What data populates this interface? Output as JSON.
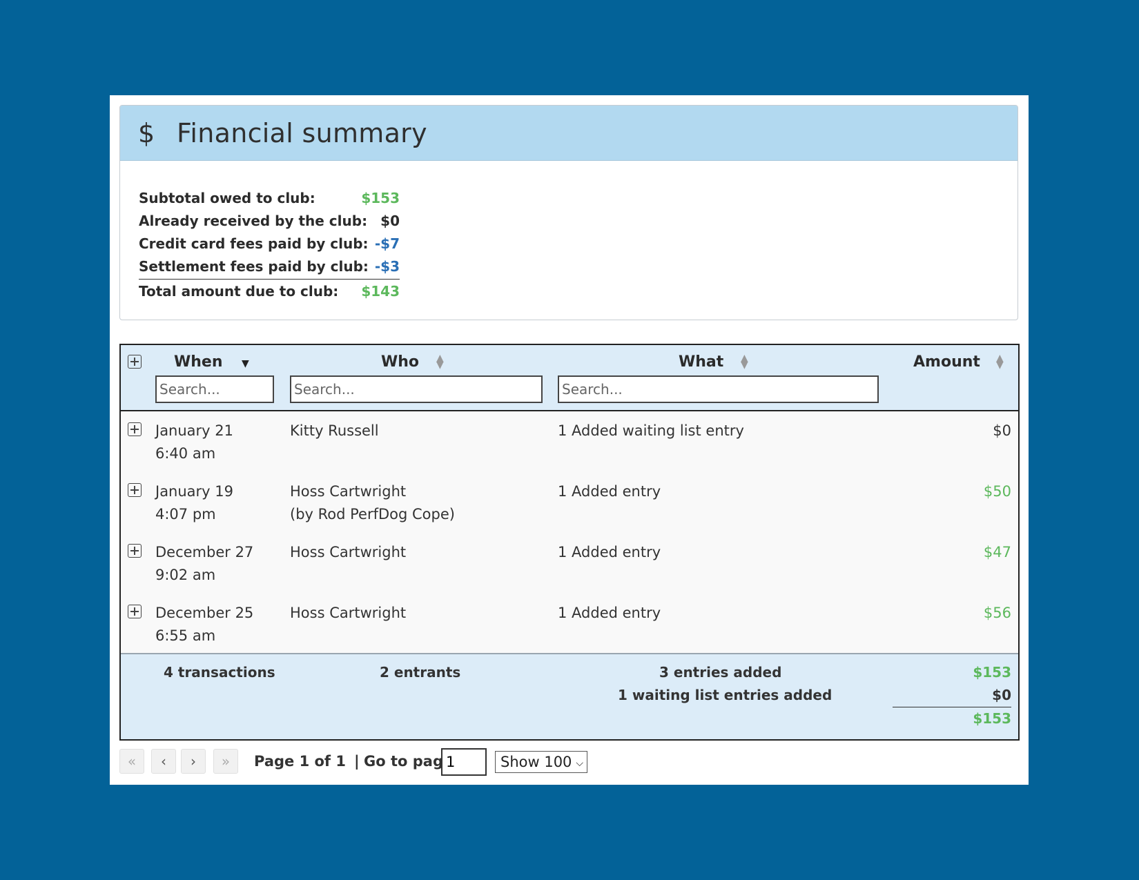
{
  "summary": {
    "title": "Financial summary",
    "icon": "$",
    "rows": [
      {
        "label": "Subtotal owed to club:",
        "value": "$153",
        "color": "#5cb85c"
      },
      {
        "label": "Already received by the club:",
        "value": "$0",
        "color": "#2b2b2b"
      },
      {
        "label": "Credit card fees paid by club:",
        "value": "-$7",
        "color": "#2a6fb5"
      },
      {
        "label": "Settlement fees paid by club:",
        "value": "-$3",
        "color": "#2a6fb5"
      }
    ],
    "total": {
      "label": "Total amount due to club:",
      "value": "$143",
      "color": "#5cb85c"
    }
  },
  "table": {
    "columns": {
      "when": "When",
      "who": "Who",
      "what": "What",
      "amount": "Amount"
    },
    "search_placeholder": "Search...",
    "rows": [
      {
        "date": "January 21",
        "time": "6:40 am",
        "who": "Kitty Russell",
        "who_sub": "",
        "what": "1 Added waiting list entry",
        "amount": "$0",
        "amount_color": "#333333"
      },
      {
        "date": "January 19",
        "time": "4:07 pm",
        "who": "Hoss Cartwright",
        "who_sub": "(by Rod PerfDog Cope)",
        "what": "1 Added entry",
        "amount": "$50",
        "amount_color": "#5cb85c"
      },
      {
        "date": "December 27",
        "time": "9:02 am",
        "who": "Hoss Cartwright",
        "who_sub": "",
        "what": "1 Added entry",
        "amount": "$47",
        "amount_color": "#5cb85c"
      },
      {
        "date": "December 25",
        "time": "6:55 am",
        "who": "Hoss Cartwright",
        "who_sub": "",
        "what": "1 Added entry",
        "amount": "$56",
        "amount_color": "#5cb85c"
      }
    ],
    "footer": {
      "transactions": "4 transactions",
      "entrants": "2 entrants",
      "entries_added": "3 entries added",
      "waiting_added": "1 waiting list entries added",
      "amount_entries": "$153",
      "amount_waiting": "$0",
      "amount_total": "$153"
    }
  },
  "pager": {
    "first": "«",
    "prev": "‹",
    "next": "›",
    "last": "»",
    "page_info": "Page 1 of 1",
    "separator": "|",
    "goto_label": "Go to page:",
    "goto_value": "1",
    "show_label": "Show 100"
  }
}
